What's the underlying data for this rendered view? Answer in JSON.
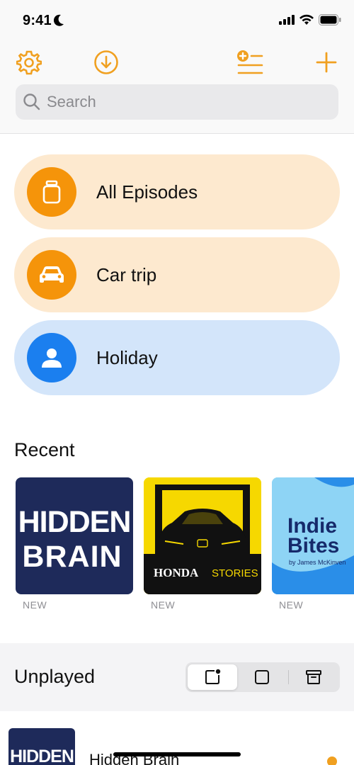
{
  "status_bar": {
    "time": "9:41"
  },
  "toolbar": {
    "icons": [
      "gear-icon",
      "download-icon",
      "add-to-list-icon",
      "plus-icon"
    ],
    "accent_color": "#f0a020"
  },
  "search": {
    "placeholder": "Search"
  },
  "stations": [
    {
      "label": "All Episodes",
      "icon": "jar-icon",
      "bg": "#fde9cf",
      "icon_bg": "#f5940a"
    },
    {
      "label": "Car trip",
      "icon": "car-icon",
      "bg": "#fde9cf",
      "icon_bg": "#f5940a"
    },
    {
      "label": "Holiday",
      "icon": "person-icon",
      "bg": "#d3e5fa",
      "icon_bg": "#1b7fef"
    }
  ],
  "recent": {
    "title": "Recent",
    "items": [
      {
        "art_line1": "HIDDEN",
        "art_line2": "BRAIN",
        "badge": "NEW"
      },
      {
        "art_brand": "HONDA",
        "art_sub": "STORIES",
        "badge": "NEW"
      },
      {
        "art_line1": "Indie",
        "art_line2": "Bites",
        "art_byline": "by James McKinven",
        "badge": "NEW"
      }
    ]
  },
  "unplayed": {
    "title": "Unplayed",
    "segments": [
      "unplayed-icon",
      "square-icon",
      "archive-icon"
    ],
    "rows": [
      {
        "art_text": "HIDDEN",
        "title": "Hidden Brain"
      }
    ]
  }
}
